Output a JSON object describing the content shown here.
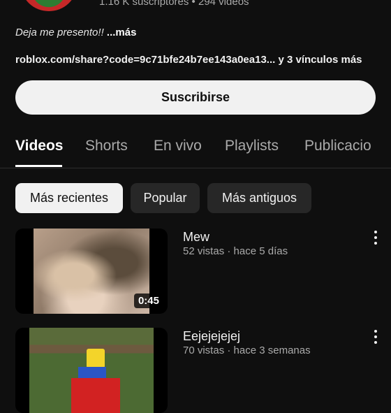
{
  "channel": {
    "stats": "1.16 K suscriptores • 294 videos",
    "description_intro": "Deja me presento!! ",
    "description_more": "...más",
    "links_text": "roblox.com/share?code=9c71bfe24b7ee143a0ea13...  y 3 vínculos más",
    "subscribe_label": "Suscribirse"
  },
  "tabs": [
    {
      "label": "Videos"
    },
    {
      "label": "Shorts"
    },
    {
      "label": "En vivo"
    },
    {
      "label": "Playlists"
    },
    {
      "label": "Publicacio"
    }
  ],
  "filters": [
    {
      "label": "Más recientes"
    },
    {
      "label": "Popular"
    },
    {
      "label": "Más antiguos"
    }
  ],
  "videos": [
    {
      "title": "Mew",
      "meta": "52 vistas · hace 5 días",
      "duration": "0:45"
    },
    {
      "title": "Eejejejejej",
      "meta": "70 vistas · hace 3 semanas",
      "duration": ""
    }
  ],
  "colors": {
    "background": "#0f0f0f",
    "text_primary": "#f1f1f1",
    "text_secondary": "#aaaaaa",
    "chip_selected": "#f1f1f1",
    "chip_normal": "#272727"
  }
}
